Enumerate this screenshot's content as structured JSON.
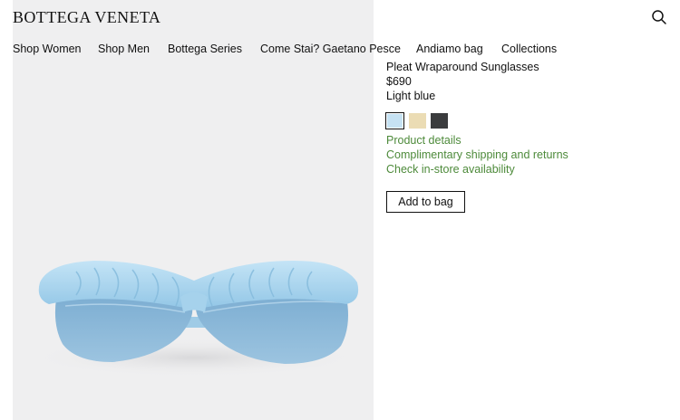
{
  "header": {
    "logo": "BOTTEGA VENETA",
    "search_icon": "search-icon"
  },
  "nav": {
    "items": [
      {
        "label": "Shop Women"
      },
      {
        "label": "Shop Men"
      },
      {
        "label": "Bottega Series"
      },
      {
        "label": "Come Stai? Gaetano Pesce"
      },
      {
        "label": "Andiamo bag"
      },
      {
        "label": "Collections"
      }
    ]
  },
  "product": {
    "name": "Pleat Wraparound Sunglasses",
    "price": "$690",
    "color_name": "Light blue",
    "swatches": [
      {
        "color": "#c6e2f3",
        "selected": true
      },
      {
        "color": "#ebdcb4",
        "selected": false
      },
      {
        "color": "#3b3c3e",
        "selected": false
      }
    ],
    "links": {
      "details": "Product details",
      "shipping": "Complimentary shipping and returns",
      "availability": "Check in-store availability"
    },
    "add_to_bag": "Add to bag"
  },
  "colors": {
    "link_green": "#4d8a3a",
    "image_background": "#efeff0",
    "frame_blue": "#a9d4ec",
    "lens_blue": "#86b4d6"
  }
}
